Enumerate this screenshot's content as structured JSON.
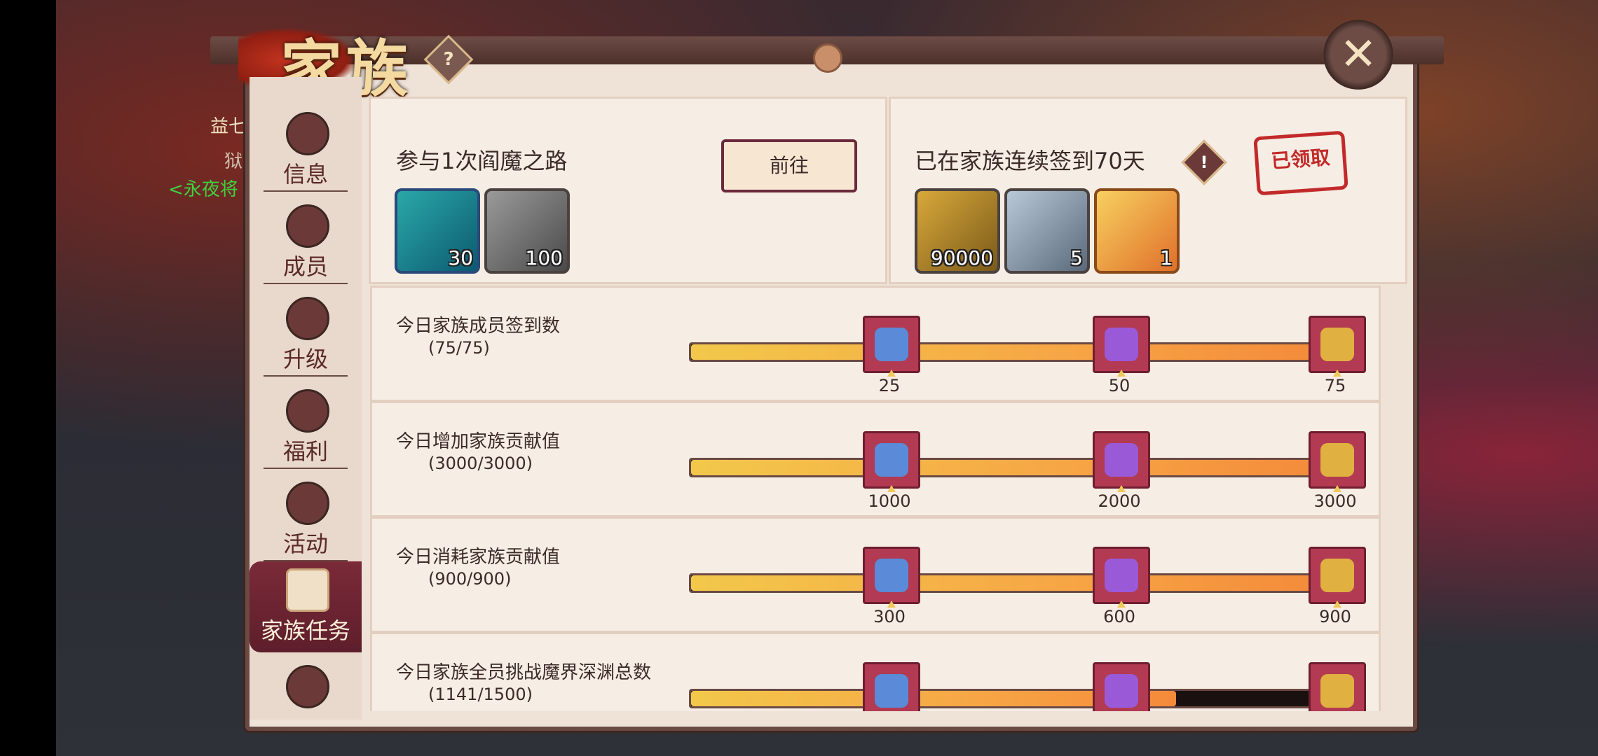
{
  "title": "家族",
  "help_glyph": "?",
  "close_glyph": "✕",
  "background": {
    "name_a": "益七",
    "name_b": "狱",
    "name_c": "<永夜将"
  },
  "sidebar": [
    {
      "label": "信息",
      "icon": "scroll-icon"
    },
    {
      "label": "成员",
      "icon": "crest-icon"
    },
    {
      "label": "升级",
      "icon": "spiral-icon"
    },
    {
      "label": "福利",
      "icon": "gift-icon"
    },
    {
      "label": "活动",
      "icon": "daruma-icon"
    },
    {
      "label": "家族任务",
      "icon": "task-icon",
      "active": true
    }
  ],
  "task_card": {
    "title": "参与1次阎魔之路",
    "button": "前往",
    "rewards": [
      {
        "count": "30"
      },
      {
        "count": "100"
      }
    ]
  },
  "signin_card": {
    "title": "已在家族连续签到70天",
    "info_glyph": "!",
    "stamp": "已领取",
    "rewards": [
      {
        "count": "90000"
      },
      {
        "count": "5"
      },
      {
        "count": "1"
      }
    ]
  },
  "rows": [
    {
      "title": "今日家族成员签到数",
      "count": "(75/75)",
      "progress": 1.0,
      "milestones": [
        "25",
        "50",
        "75"
      ]
    },
    {
      "title": "今日增加家族贡献值",
      "count": "(3000/3000)",
      "progress": 1.0,
      "milestones": [
        "1000",
        "2000",
        "3000"
      ]
    },
    {
      "title": "今日消耗家族贡献值",
      "count": "(900/900)",
      "progress": 1.0,
      "milestones": [
        "300",
        "600",
        "900"
      ]
    },
    {
      "title": "今日家族全员挑战魔界深渊总数",
      "count": "(1141/1500)",
      "progress": 0.7607,
      "milestones": [
        "",
        "",
        ""
      ]
    }
  ]
}
